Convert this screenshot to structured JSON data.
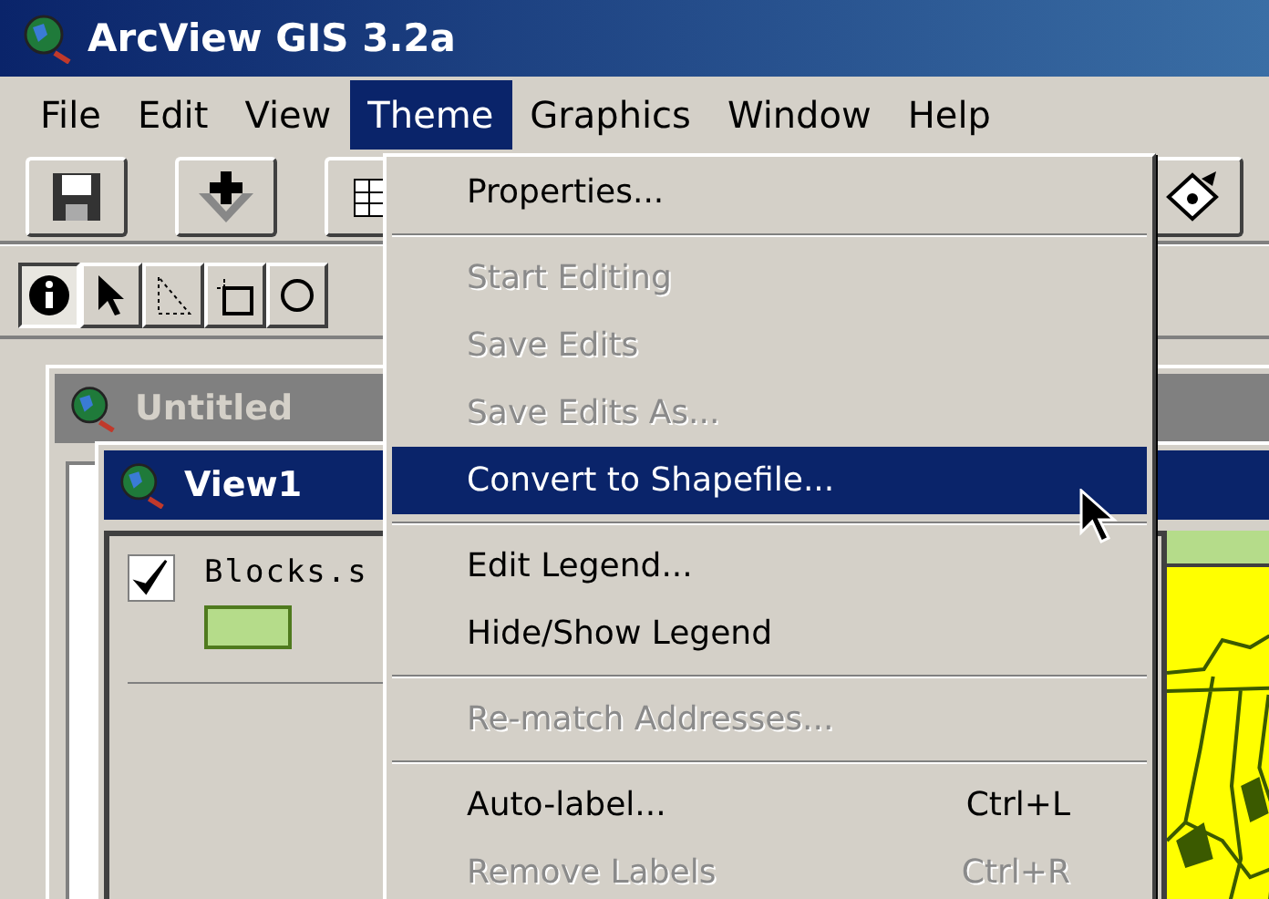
{
  "window": {
    "title": "ArcView GIS 3.2a"
  },
  "menubar": [
    {
      "label": "File",
      "selected": false
    },
    {
      "label": "Edit",
      "selected": false
    },
    {
      "label": "View",
      "selected": false
    },
    {
      "label": "Theme",
      "selected": true
    },
    {
      "label": "Graphics",
      "selected": false
    },
    {
      "label": "Window",
      "selected": false
    },
    {
      "label": "Help",
      "selected": false
    }
  ],
  "theme_menu": [
    {
      "kind": "item",
      "label": "Properties...",
      "disabled": false,
      "selected": false
    },
    {
      "kind": "separator"
    },
    {
      "kind": "item",
      "label": "Start Editing",
      "disabled": true,
      "selected": false
    },
    {
      "kind": "item",
      "label": "Save Edits",
      "disabled": true,
      "selected": false
    },
    {
      "kind": "item",
      "label": "Save Edits As...",
      "disabled": true,
      "selected": false
    },
    {
      "kind": "item",
      "label": "Convert to Shapefile...",
      "disabled": false,
      "selected": true
    },
    {
      "kind": "separator"
    },
    {
      "kind": "item",
      "label": "Edit Legend...",
      "disabled": false,
      "selected": false
    },
    {
      "kind": "item",
      "label": "Hide/Show Legend",
      "disabled": false,
      "selected": false
    },
    {
      "kind": "separator"
    },
    {
      "kind": "item",
      "label": "Re-match Addresses...",
      "disabled": true,
      "selected": false
    },
    {
      "kind": "separator"
    },
    {
      "kind": "item",
      "label": "Auto-label...",
      "shortcut": "Ctrl+L",
      "disabled": false,
      "selected": false
    },
    {
      "kind": "item",
      "label": "Remove Labels",
      "shortcut": "Ctrl+R",
      "disabled": true,
      "selected": false
    }
  ],
  "windows": [
    {
      "title": "Untitled",
      "active": false
    },
    {
      "title": "View1",
      "active": true
    }
  ],
  "legend": [
    {
      "name": "Blocks.s",
      "checked": true,
      "color": "#b5dc8a"
    }
  ]
}
